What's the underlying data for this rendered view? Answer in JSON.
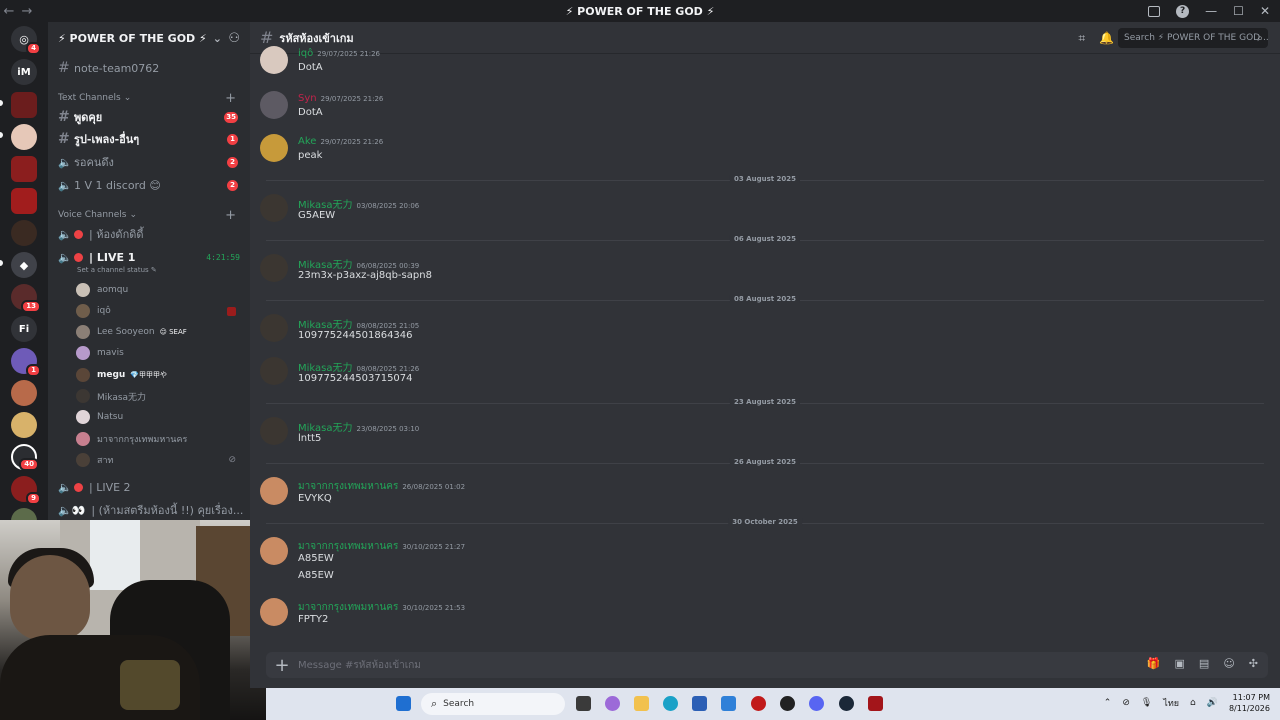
{
  "window": {
    "title": "⚡ POWER OF THE GOD ⚡"
  },
  "server": {
    "name": "⚡ POWER OF THE GOD ⚡"
  },
  "rail": {
    "badges": {
      "home": "4",
      "s12": "13",
      "s14": "1",
      "s17": "40",
      "s18": "9"
    },
    "labels": {
      "im": "iM",
      "fi": "Fi"
    }
  },
  "sidebar": {
    "top_channel": "note-team0762",
    "text_category": "Text Channels",
    "text_channels": [
      {
        "name": "พูดคุย",
        "count": "35"
      },
      {
        "name": "รูป-เพลง-อื่นๆ",
        "count": "1"
      },
      {
        "name": "รอคนดึง",
        "count": "2"
      },
      {
        "name": "1 V 1 discord 😊",
        "count": "2"
      }
    ],
    "voice_category": "Voice Channels",
    "voice_channels": [
      {
        "name": "| ห้องดักดิดี้"
      },
      {
        "name": "| LIVE 1",
        "timer": "4:21:59",
        "status": "Set a channel status ✎"
      }
    ],
    "voice_users": [
      {
        "name": "aomqu",
        "tag": ""
      },
      {
        "name": "iqô",
        "tag": ""
      },
      {
        "name": "Lee Sooyeon",
        "tag": "😌 SEAF"
      },
      {
        "name": "mavis",
        "tag": ""
      },
      {
        "name": "megu",
        "tag": "💎甲甲甲や"
      },
      {
        "name": "Mikasa无力",
        "tag": ""
      },
      {
        "name": "Natsu",
        "tag": ""
      },
      {
        "name": "มาจากกรุงเทพมหานคร",
        "tag": ""
      },
      {
        "name": "สาท",
        "tag": ""
      }
    ],
    "voice_channels_after": [
      {
        "name": "| LIVE 2"
      },
      {
        "name": "| (ห้ามสตรีมห้องนี้ !!) คุยเรื่อง..."
      }
    ]
  },
  "chat": {
    "channel": "รหัสห้องเข้าเกม",
    "search_placeholder": "Search ⚡ POWER OF THE GOD ...",
    "composer_placeholder": "Message #รหัสห้องเข้าเกม",
    "messages": [
      {
        "author": "iqô",
        "time": "29/07/2025 21:26",
        "text": "DotA",
        "color": "#23a559"
      },
      {
        "author": "Syn",
        "time": "29/07/2025 21:26",
        "text": "DotA",
        "color": "#c0244b"
      },
      {
        "author": "Ake",
        "time": "29/07/2025 21:26",
        "text": "peak",
        "color": "#23a559"
      },
      {
        "author": "Mikasa无力",
        "time": "03/08/2025 20:06",
        "text": "G5AEW",
        "color": "#23a559"
      },
      {
        "author": "Mikasa无力",
        "time": "06/08/2025 00:39",
        "text": "23m3x-p3axz-aj8qb-sapn8",
        "color": "#23a559"
      },
      {
        "author": "Mikasa无力",
        "time": "08/08/2025 21:05",
        "text": "109775244501864346",
        "color": "#23a559"
      },
      {
        "author": "Mikasa无力",
        "time": "08/08/2025 21:26",
        "text": "109775244503715074",
        "color": "#23a559"
      },
      {
        "author": "Mikasa无力",
        "time": "23/08/2025 03:10",
        "text": "lntt5",
        "color": "#23a559"
      },
      {
        "author": "มาจากกรุงเทพมหานคร",
        "time": "26/08/2025 01:02",
        "text": "EVYKQ",
        "color": "#23a559"
      },
      {
        "author": "มาจากกรุงเทพมหานคร",
        "time": "30/10/2025 21:27",
        "text": "A85EW",
        "text2": "A85EW",
        "color": "#23a559"
      },
      {
        "author": "มาจากกรุงเทพมหานคร",
        "time": "30/10/2025 21:53",
        "text": "FPTY2",
        "color": "#23a559"
      }
    ],
    "dividers": [
      "03 August 2025",
      "06 August 2025",
      "08 August 2025",
      "23 August 2025",
      "26 August 2025",
      "30 October 2025"
    ]
  },
  "taskbar": {
    "search": "Search",
    "lang": "ไทย",
    "time": "11:07 PM",
    "date": "8/11/2026"
  },
  "colors": {
    "accent": "#5865f2",
    "unread_badge": "#f23f43",
    "author_green": "#23a559",
    "author_red": "#c0244b"
  }
}
